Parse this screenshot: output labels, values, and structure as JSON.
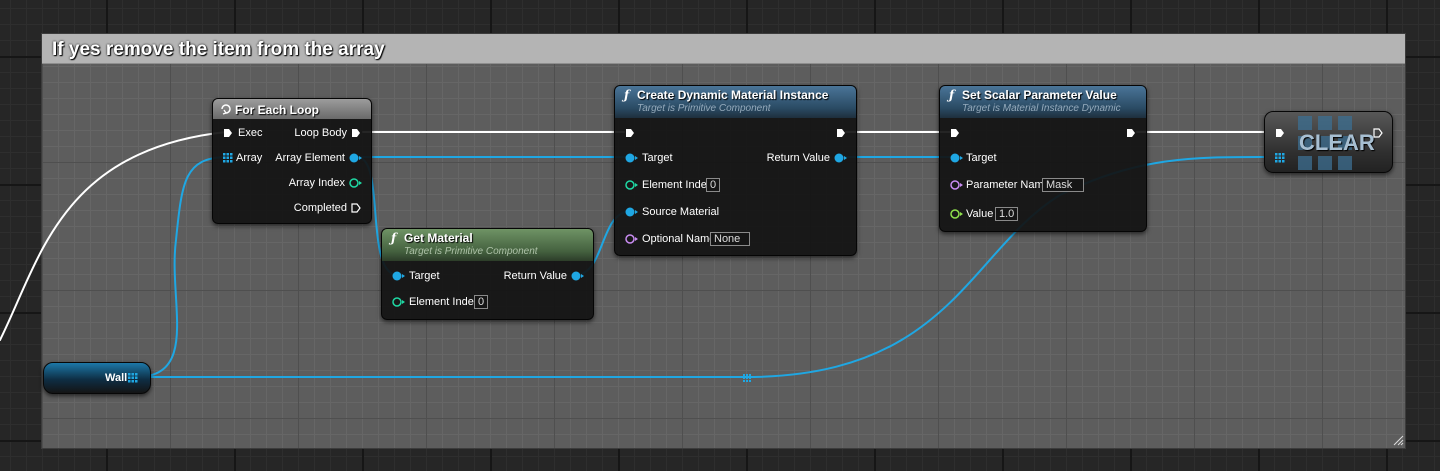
{
  "comment": {
    "title": "If yes remove the item from the array"
  },
  "colors": {
    "exec": "#ffffff",
    "object_pin": "#1fa7e3",
    "int_pin": "#1fd9a4",
    "name_pin": "#c98cf2",
    "float_pin": "#8fe04d",
    "comment_bg": "#5d5d5d",
    "comment_header": "#b4b4b4",
    "func_header": "#355a78",
    "pure_header": "#4f6f49"
  },
  "nodes": {
    "for_each": {
      "title": "For Each Loop",
      "icon": "loop-icon",
      "inputs": [
        "Exec",
        "Array"
      ],
      "outputs": [
        "Loop Body",
        "Array Element",
        "Array Index",
        "Completed"
      ]
    },
    "get_material": {
      "title": "Get Material",
      "subtitle": "Target is Primitive Component",
      "target": "Target",
      "element_index_label": "Element Index",
      "element_index_value": "0",
      "return_value": "Return Value"
    },
    "create_dmi": {
      "title": "Create Dynamic Material Instance",
      "subtitle": "Target is Primitive Component",
      "target": "Target",
      "element_index_label": "Element Index",
      "element_index_value": "0",
      "source_material": "Source Material",
      "optional_name_label": "Optional Name",
      "optional_name_value": "None",
      "return_value": "Return Value"
    },
    "set_scalar": {
      "title": "Set Scalar Parameter Value",
      "subtitle": "Target is Material Instance Dynamic",
      "target": "Target",
      "param_label": "Parameter Name",
      "param_value": "Mask",
      "value_label": "Value",
      "value_value": "1.0"
    },
    "wall": {
      "label": "Wall"
    },
    "clear": {
      "label": "CLEAR"
    }
  }
}
